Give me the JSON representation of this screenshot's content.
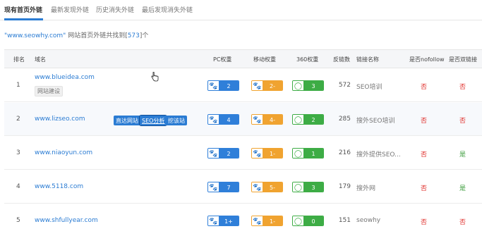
{
  "tabs": [
    {
      "label": "现有首页外链"
    },
    {
      "label": "最新发现外链"
    },
    {
      "label": "历史消失外链"
    },
    {
      "label": "最后发现消失外链"
    }
  ],
  "summary": {
    "domain_quoted": "\"www.seowhy.com\"",
    "middle": " 网站首页外链共找到[",
    "count": "573",
    "suffix": "]个"
  },
  "table": {
    "headers": {
      "rank": "排名",
      "domain": "域名",
      "pc": "PC权重",
      "mobile": "移动权重",
      "w360": "360权重",
      "backlinks": "反链数",
      "linkname": "链接名称",
      "nofollow": "是否nofollow",
      "twoway": "是否双链接"
    },
    "rows": [
      {
        "rank": "1",
        "domain": "www.blueidea.com",
        "tag": "网站建设",
        "pc": "2",
        "mobile": "2-",
        "w360": "3",
        "backlinks": "572",
        "linkname": "SEO培训",
        "nofollow": "否",
        "twoway": "否"
      },
      {
        "rank": "2",
        "domain": "www.lizseo.com",
        "pc": "4",
        "mobile": "4-",
        "w360": "2",
        "backlinks": "285",
        "linkname": "搜外SEO培训",
        "nofollow": "否",
        "twoway": "否"
      },
      {
        "rank": "3",
        "domain": "www.niaoyun.com",
        "pc": "2",
        "mobile": "1-",
        "w360": "1",
        "backlinks": "216",
        "linkname": "搜外提供SEO...",
        "nofollow": "否",
        "twoway": "是"
      },
      {
        "rank": "4",
        "domain": "www.5118.com",
        "pc": "7",
        "mobile": "5-",
        "w360": "3",
        "backlinks": "179",
        "linkname": "搜外网",
        "nofollow": "否",
        "twoway": "是"
      },
      {
        "rank": "5",
        "domain": "www.shfullyear.com",
        "pc": "1+",
        "mobile": "1-",
        "w360": "0",
        "backlinks": "151",
        "linkname": "seowhy",
        "nofollow": "否",
        "twoway": "否"
      }
    ]
  },
  "row_actions": {
    "visit": "直达网站",
    "seo_analysis": "SEO分析",
    "dig_site": "挖该站"
  },
  "icons": {
    "pc": "baidu-paw-icon",
    "mobile": "baidu-paw-icon",
    "w360": "360-ring-icon",
    "cursor": "hand-pointer-icon"
  },
  "colors": {
    "link": "#2b7cd3",
    "pc_badge": "#2f7fd9",
    "mobile_badge": "#f0a330",
    "badge_360": "#3dac45",
    "no": "#e0332f",
    "yes": "#3a9b3a"
  }
}
